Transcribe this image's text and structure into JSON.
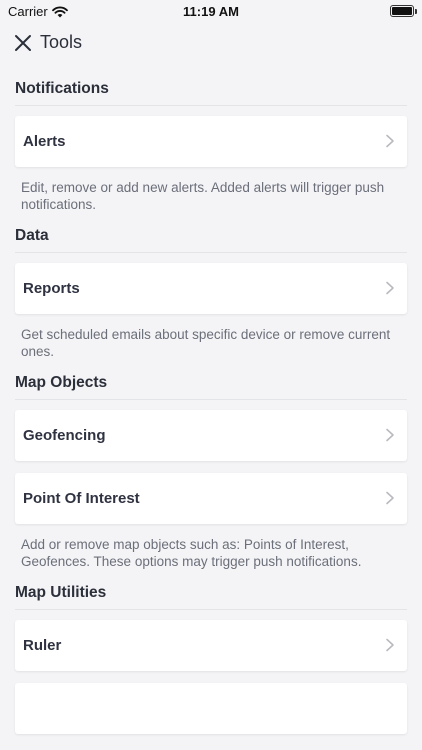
{
  "status_bar": {
    "carrier": "Carrier",
    "time": "11:19 AM"
  },
  "nav": {
    "title": "Tools"
  },
  "sections": [
    {
      "title": "Notifications",
      "items": [
        {
          "label": "Alerts"
        }
      ],
      "description": "Edit, remove or add new alerts. Added alerts will trigger push notifications."
    },
    {
      "title": "Data",
      "items": [
        {
          "label": "Reports"
        }
      ],
      "description": "Get scheduled emails about specific device or remove current ones."
    },
    {
      "title": "Map Objects",
      "items": [
        {
          "label": "Geofencing"
        },
        {
          "label": "Point Of Interest"
        }
      ],
      "description": "Add or remove map objects such as: Points of Interest, Geofences. These options may trigger push notifications."
    },
    {
      "title": "Map Utilities",
      "items": [
        {
          "label": "Ruler"
        },
        {
          "label": ""
        }
      ]
    }
  ],
  "icons": {
    "close": "close-icon",
    "chevron": "chevron-right-icon",
    "wifi": "wifi-icon",
    "battery": "battery-icon"
  },
  "colors": {
    "background": "#f4f4f6",
    "card": "#ffffff",
    "text": "#2b2f3a",
    "muted": "#6b6f7a"
  }
}
